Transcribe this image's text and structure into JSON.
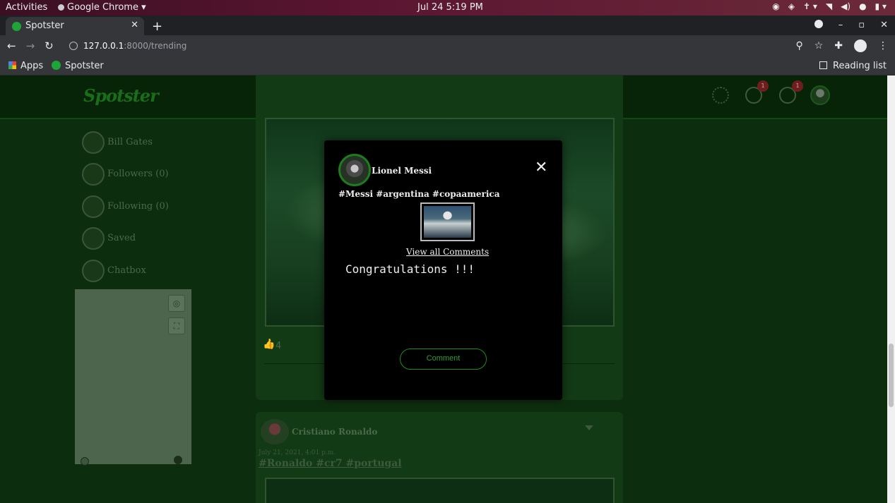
{
  "os": {
    "activities": "Activities",
    "app_menu": "Google Chrome",
    "clock": "Jul 24  5:19 PM"
  },
  "browser": {
    "tab_title": "Spotster",
    "url_host": "127.0.0.1",
    "url_rest": ":8000/trending",
    "bookmarks": {
      "apps": "Apps",
      "spotster": "Spotster",
      "reading_list": "Reading list"
    }
  },
  "site": {
    "logo": "Spotster",
    "nav_badges": {
      "messages": "1",
      "notifications": "1"
    },
    "sidebar": {
      "items": [
        {
          "label": "Bill Gates",
          "icon": "user-avatar-icon"
        },
        {
          "label": "Followers (0)",
          "icon": "followers-icon"
        },
        {
          "label": "Following (0)",
          "icon": "following-icon"
        },
        {
          "label": "Saved",
          "icon": "bookmark-icon"
        },
        {
          "label": "Chatbox",
          "icon": "chat-icon"
        }
      ]
    },
    "feed": {
      "post1": {
        "likes": "4"
      },
      "post2": {
        "author": "Cristiano Ronaldo",
        "date": "July 21, 2021, 4:01 p.m.",
        "tags": "#Ronaldo #cr7 #portugal"
      }
    }
  },
  "modal": {
    "author": "Lionel Messi",
    "tags": "#Messi #argentina #copaamerica",
    "view_all": "View all Comments",
    "comment": "Congratulations !!!",
    "comment_button": "Comment"
  },
  "colors": {
    "accent": "#1d8d1d",
    "page_bg": "#0d2e0e",
    "modal_bg": "#000000"
  }
}
